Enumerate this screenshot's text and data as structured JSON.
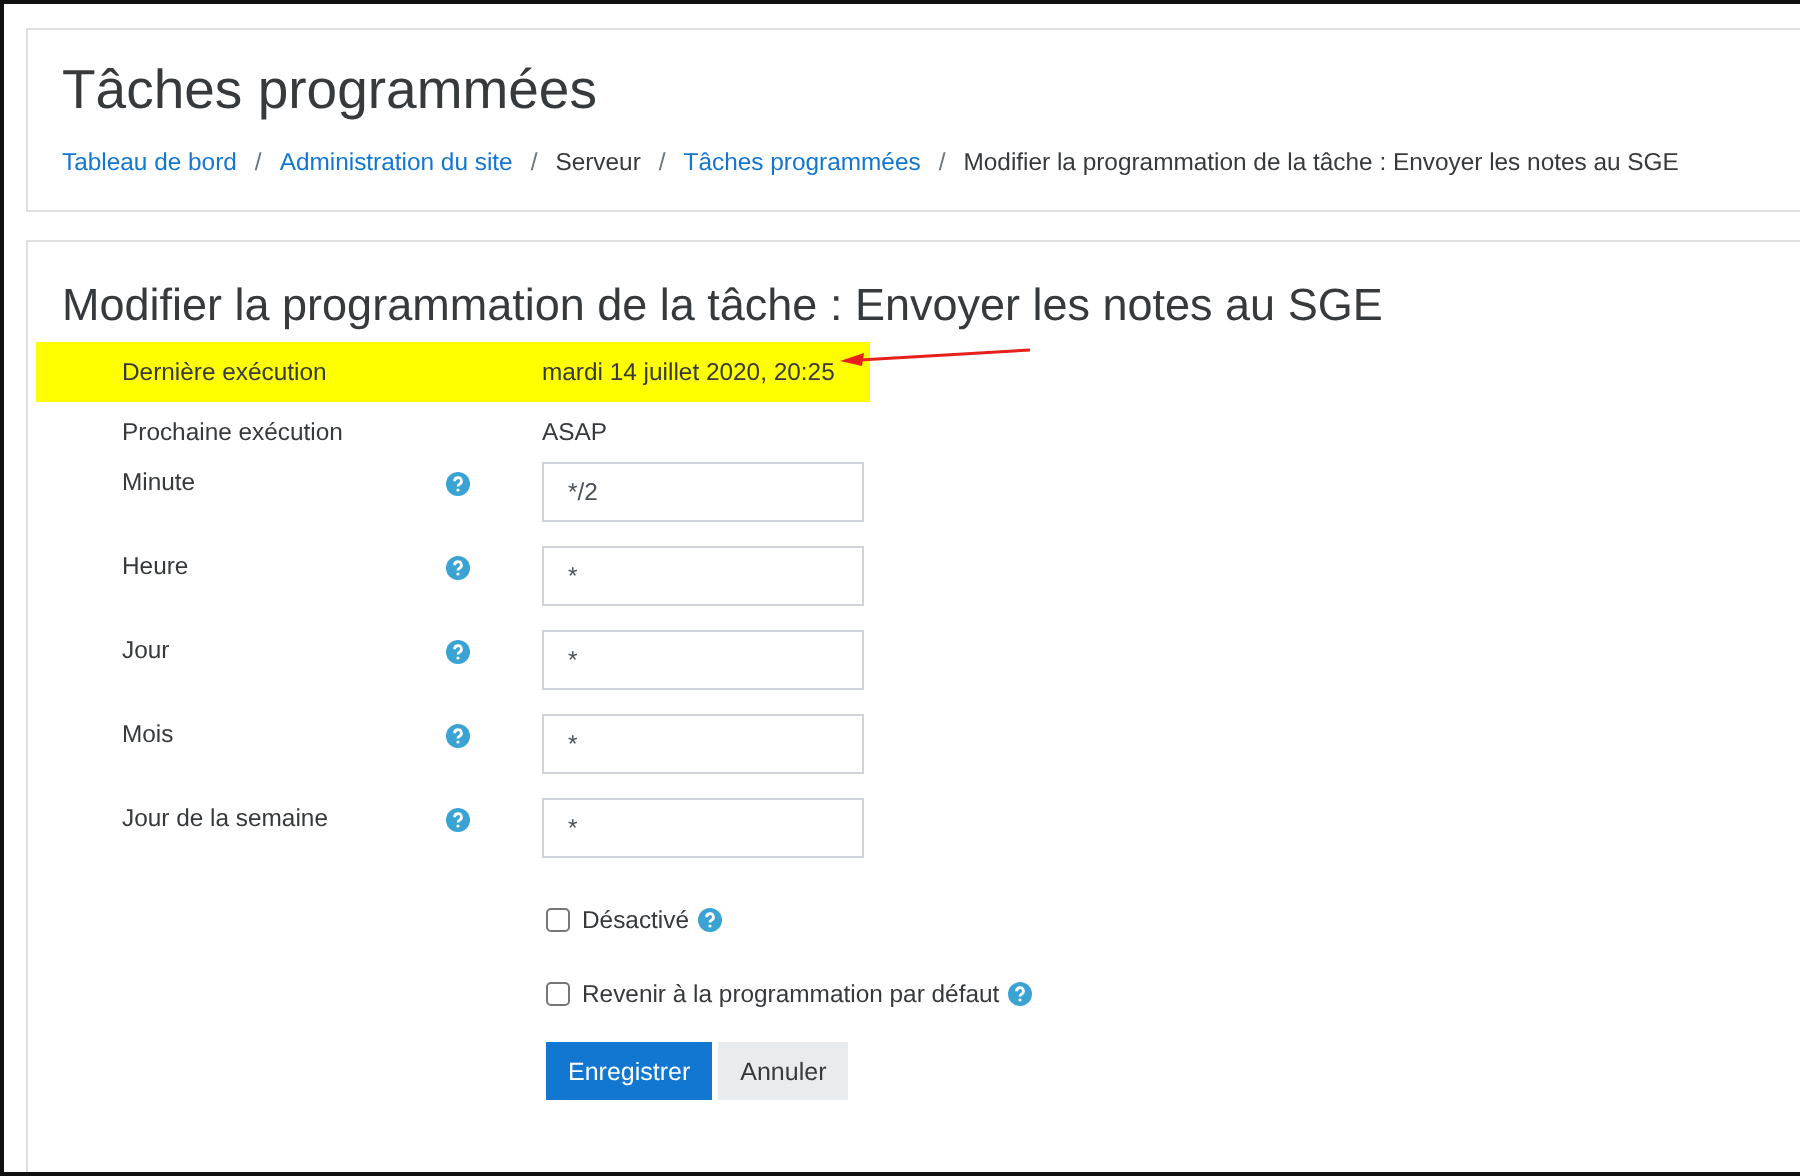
{
  "header": {
    "title": "Tâches programmées",
    "breadcrumb": [
      {
        "kind": "link",
        "label": "Tableau de bord"
      },
      {
        "kind": "separator",
        "label": "/"
      },
      {
        "kind": "link",
        "label": "Administration du site"
      },
      {
        "kind": "separator",
        "label": "/"
      },
      {
        "kind": "text",
        "label": "Serveur"
      },
      {
        "kind": "separator",
        "label": "/"
      },
      {
        "kind": "link",
        "label": "Tâches programmées"
      },
      {
        "kind": "separator",
        "label": "/"
      },
      {
        "kind": "text",
        "label": "Modifier la programmation de la tâche : Envoyer les notes au SGE"
      }
    ]
  },
  "form": {
    "title": "Modifier la programmation de la tâche : Envoyer les notes au SGE",
    "rows": [
      {
        "kind": "info",
        "label": "Dernière exécution",
        "value": "mardi 14 juillet 2020, 20:25",
        "highlighted": true,
        "annotated": true
      },
      {
        "kind": "info",
        "label": "Prochaine exécution",
        "value": "ASAP",
        "highlighted": false,
        "annotated": false
      },
      {
        "kind": "text",
        "label": "Minute",
        "value": "*/2",
        "help": true
      },
      {
        "kind": "text",
        "label": "Heure",
        "value": "*",
        "help": true
      },
      {
        "kind": "text",
        "label": "Jour",
        "value": "*",
        "help": true
      },
      {
        "kind": "text",
        "label": "Mois",
        "value": "*",
        "help": true
      },
      {
        "kind": "text",
        "label": "Jour de la semaine",
        "value": "*",
        "help": true
      },
      {
        "kind": "checkbox",
        "label": "Désactivé",
        "checked": false,
        "help": true
      },
      {
        "kind": "checkbox",
        "label": "Revenir à la programmation par défaut",
        "checked": false,
        "help": true
      }
    ],
    "buttons": [
      {
        "label": "Enregistrer",
        "primary": true
      },
      {
        "label": "Annuler",
        "primary": false
      }
    ]
  }
}
